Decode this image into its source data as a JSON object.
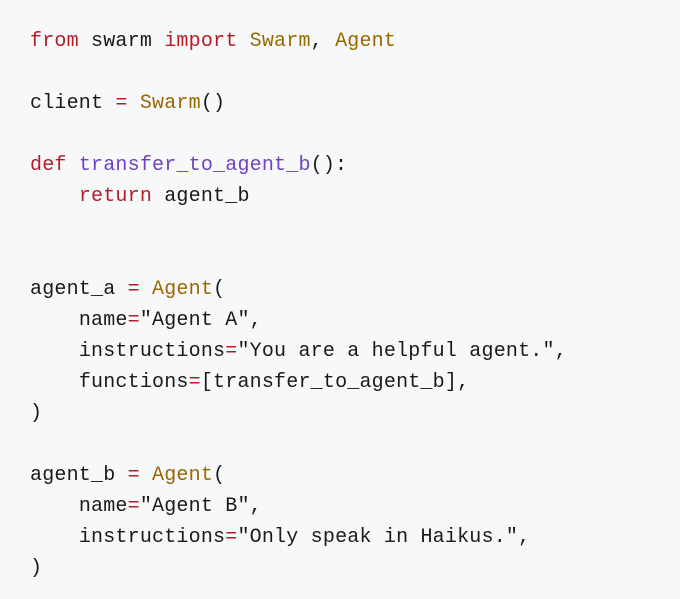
{
  "code": {
    "line1": {
      "from": "from",
      "module": "swarm",
      "import": "import",
      "class1": "Swarm",
      "comma": ", ",
      "class2": "Agent"
    },
    "line3": {
      "var": "client ",
      "eq": "=",
      "sp": " ",
      "class": "Swarm",
      "call": "()"
    },
    "line5": {
      "def": "def",
      "sp": " ",
      "fname": "transfer_to_agent_b",
      "sig": "():"
    },
    "line6": {
      "indent": "    ",
      "return": "return",
      "sp": " ",
      "var": "agent_b"
    },
    "line9": {
      "var": "agent_a ",
      "eq": "=",
      "sp": " ",
      "class": "Agent",
      "open": "("
    },
    "line10": {
      "indent": "    ",
      "kw": "name",
      "eq": "=",
      "str": "\"Agent A\"",
      "comma": ","
    },
    "line11": {
      "indent": "    ",
      "kw": "instructions",
      "eq": "=",
      "str": "\"You are a helpful agent.\"",
      "comma": ","
    },
    "line12": {
      "indent": "    ",
      "kw": "functions",
      "eq": "=",
      "open": "[",
      "val": "transfer_to_agent_b",
      "close": "],"
    },
    "line13": {
      "close": ")"
    },
    "line15": {
      "var": "agent_b ",
      "eq": "=",
      "sp": " ",
      "class": "Agent",
      "open": "("
    },
    "line16": {
      "indent": "    ",
      "kw": "name",
      "eq": "=",
      "str": "\"Agent B\"",
      "comma": ","
    },
    "line17": {
      "indent": "    ",
      "kw": "instructions",
      "eq": "=",
      "str": "\"Only speak in Haikus.\"",
      "comma": ","
    },
    "line18": {
      "close": ")"
    }
  }
}
